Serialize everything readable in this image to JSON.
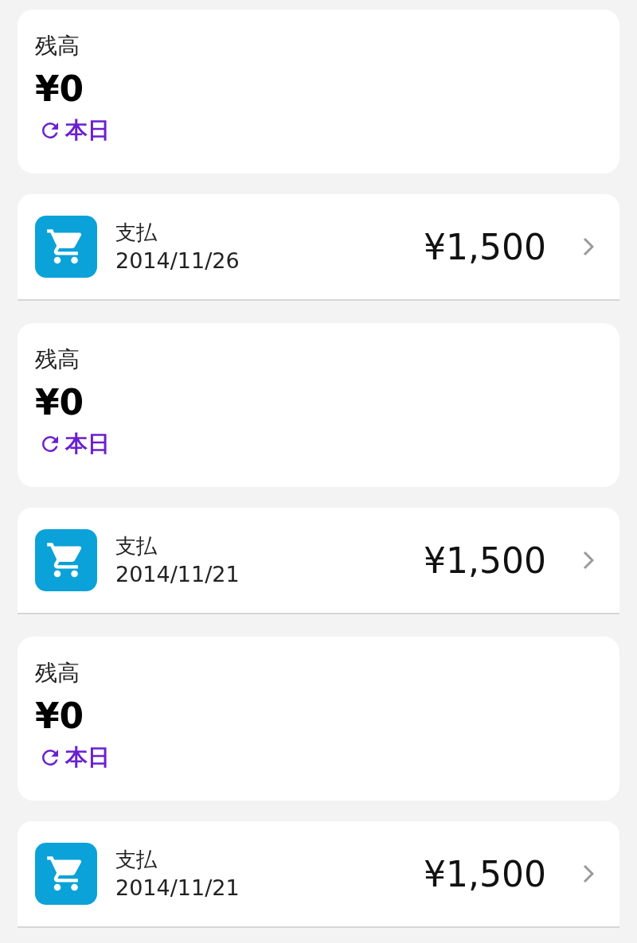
{
  "entries": [
    {
      "balance": {
        "label": "残高",
        "amount": "¥0",
        "refresh_label": "本日"
      },
      "transaction": {
        "title": "支払",
        "date": "2014/11/26",
        "amount": "¥1,500"
      }
    },
    {
      "balance": {
        "label": "残高",
        "amount": "¥0",
        "refresh_label": "本日"
      },
      "transaction": {
        "title": "支払",
        "date": "2014/11/21",
        "amount": "¥1,500"
      }
    },
    {
      "balance": {
        "label": "残高",
        "amount": "¥0",
        "refresh_label": "本日"
      },
      "transaction": {
        "title": "支払",
        "date": "2014/11/21",
        "amount": "¥1,500"
      }
    }
  ]
}
